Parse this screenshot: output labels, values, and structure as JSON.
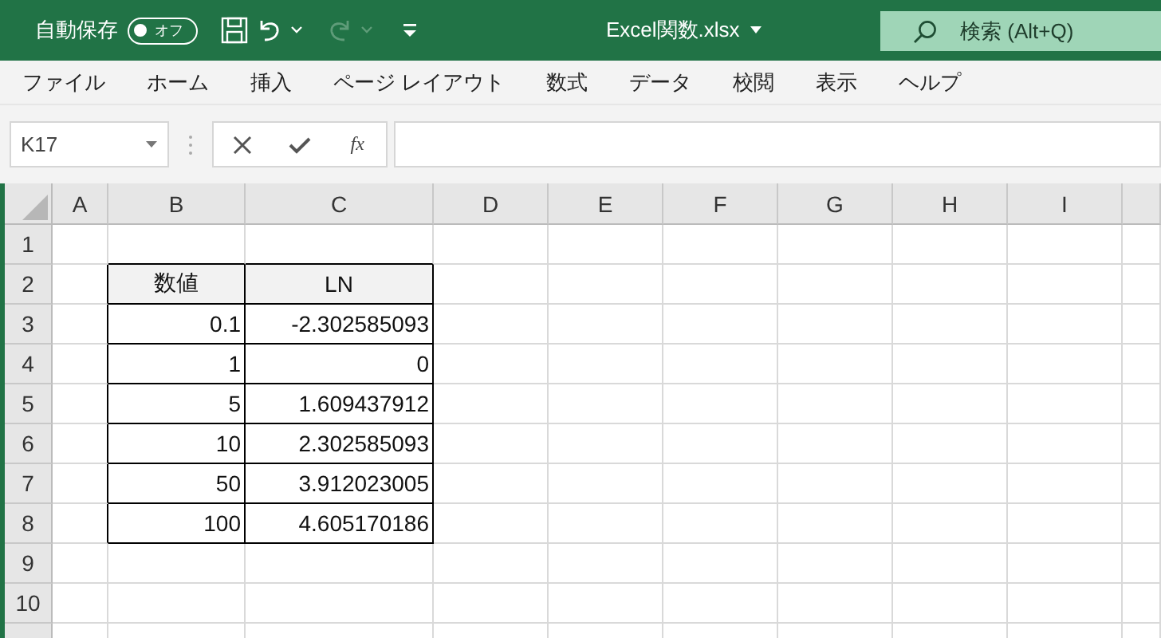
{
  "title_bar": {
    "autosave": {
      "label": "自動保存",
      "on": false,
      "state_text": "オフ"
    },
    "redo_disabled": true,
    "title": "Excel関数.xlsx",
    "search": {
      "placeholder": "検索 (Alt+Q)"
    }
  },
  "menu": [
    "ファイル",
    "ホーム",
    "挿入",
    "ページ レイアウト",
    "数式",
    "データ",
    "校閲",
    "表示",
    "ヘルプ"
  ],
  "formula_bar": {
    "name_box": "K17",
    "function_label": "fx"
  },
  "sheet": {
    "columns": [
      "A",
      "B",
      "C",
      "D",
      "E",
      "F",
      "G",
      "H",
      "I"
    ],
    "rows": [
      "1",
      "2",
      "3",
      "4",
      "5",
      "6",
      "7",
      "8",
      "9",
      "10"
    ],
    "table": {
      "header": [
        "数値",
        "LN"
      ],
      "rows": [
        [
          "0.1",
          "-2.302585093"
        ],
        [
          "1",
          "0"
        ],
        [
          "5",
          "1.609437912"
        ],
        [
          "10",
          "2.302585093"
        ],
        [
          "50",
          "3.912023005"
        ],
        [
          "100",
          "4.605170186"
        ]
      ]
    }
  }
}
